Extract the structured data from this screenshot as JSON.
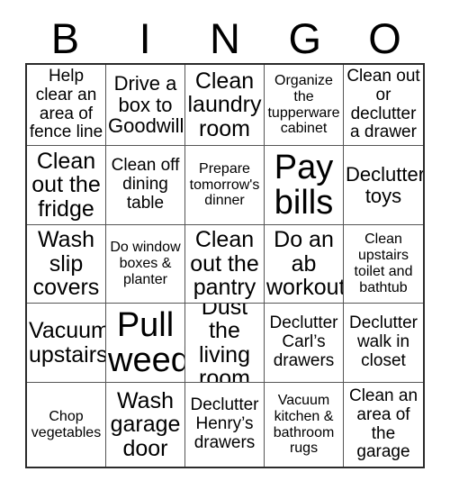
{
  "header": {
    "letters": [
      "B",
      "I",
      "N",
      "G",
      "O"
    ]
  },
  "grid": {
    "rows": [
      [
        {
          "text": "Help clear an area of fence line",
          "size": "fs-md"
        },
        {
          "text": "Drive a box to Goodwill",
          "size": "fs-lg"
        },
        {
          "text": "Clean laundry room",
          "size": "fs-xl"
        },
        {
          "text": "Organize the tupperware cabinet",
          "size": "fs-sm"
        },
        {
          "text": "Clean out or declutter a drawer",
          "size": "fs-md"
        }
      ],
      [
        {
          "text": "Clean out the fridge",
          "size": "fs-xl"
        },
        {
          "text": "Clean off dining table",
          "size": "fs-md"
        },
        {
          "text": "Prepare tomorrow's dinner",
          "size": "fs-sm"
        },
        {
          "text": "Pay bills",
          "size": "fs-xxl"
        },
        {
          "text": "Declutter toys",
          "size": "fs-lg"
        }
      ],
      [
        {
          "text": "Wash slip covers",
          "size": "fs-xl"
        },
        {
          "text": "Do window boxes & planter",
          "size": "fs-sm"
        },
        {
          "text": "Clean out the pantry",
          "size": "fs-xl"
        },
        {
          "text": "Do an ab workout",
          "size": "fs-xl"
        },
        {
          "text": "Clean upstairs toilet and bathtub",
          "size": "fs-sm"
        }
      ],
      [
        {
          "text": "Vacuum upstairs",
          "size": "fs-xl"
        },
        {
          "text": "Pull weeds",
          "size": "fs-xxl"
        },
        {
          "text": "Dust the living room",
          "size": "fs-xl"
        },
        {
          "text": "Declutter Carl’s drawers",
          "size": "fs-md"
        },
        {
          "text": "Declutter walk in closet",
          "size": "fs-md"
        }
      ],
      [
        {
          "text": "Chop vegetables",
          "size": "fs-sm"
        },
        {
          "text": "Wash garage door",
          "size": "fs-xl"
        },
        {
          "text": "Declutter Henry’s drawers",
          "size": "fs-md"
        },
        {
          "text": "Vacuum kitchen & bathroom rugs",
          "size": "fs-sm"
        },
        {
          "text": "Clean an area of the garage",
          "size": "fs-md"
        }
      ]
    ]
  },
  "colors": {
    "background": "#ffffff",
    "text": "#000000",
    "outer_border": "#2b2b2b",
    "inner_border": "#555555"
  }
}
